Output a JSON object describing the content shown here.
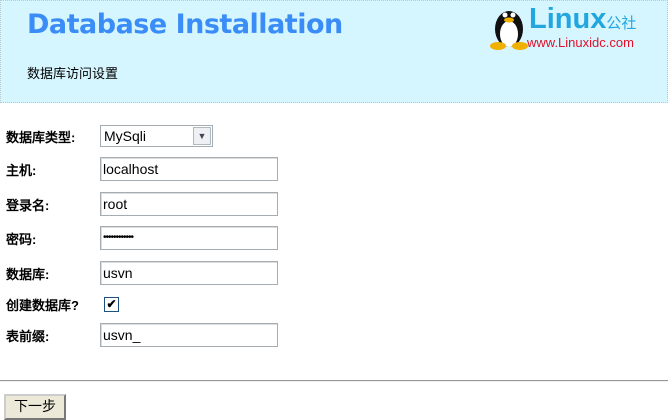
{
  "header": {
    "title": "Database Installation",
    "subtitle": "数据库访问设置",
    "logo": {
      "brand": "Linux",
      "brand_suffix": "公社",
      "url": "www.Linuxidc.com"
    }
  },
  "form": {
    "db_type": {
      "label": "数据库类型:",
      "value": "MySqli"
    },
    "host": {
      "label": "主机:",
      "value": "localhost"
    },
    "login": {
      "label": "登录名:",
      "value": "root"
    },
    "password": {
      "label": "密码:",
      "value": "••••••••••••"
    },
    "database": {
      "label": "数据库:",
      "value": "usvn"
    },
    "create_db": {
      "label": "创建数据库?",
      "checked": true,
      "mark": "✔"
    },
    "prefix": {
      "label": "表前缀:",
      "value": "usvn_"
    }
  },
  "next_button": "下一步"
}
